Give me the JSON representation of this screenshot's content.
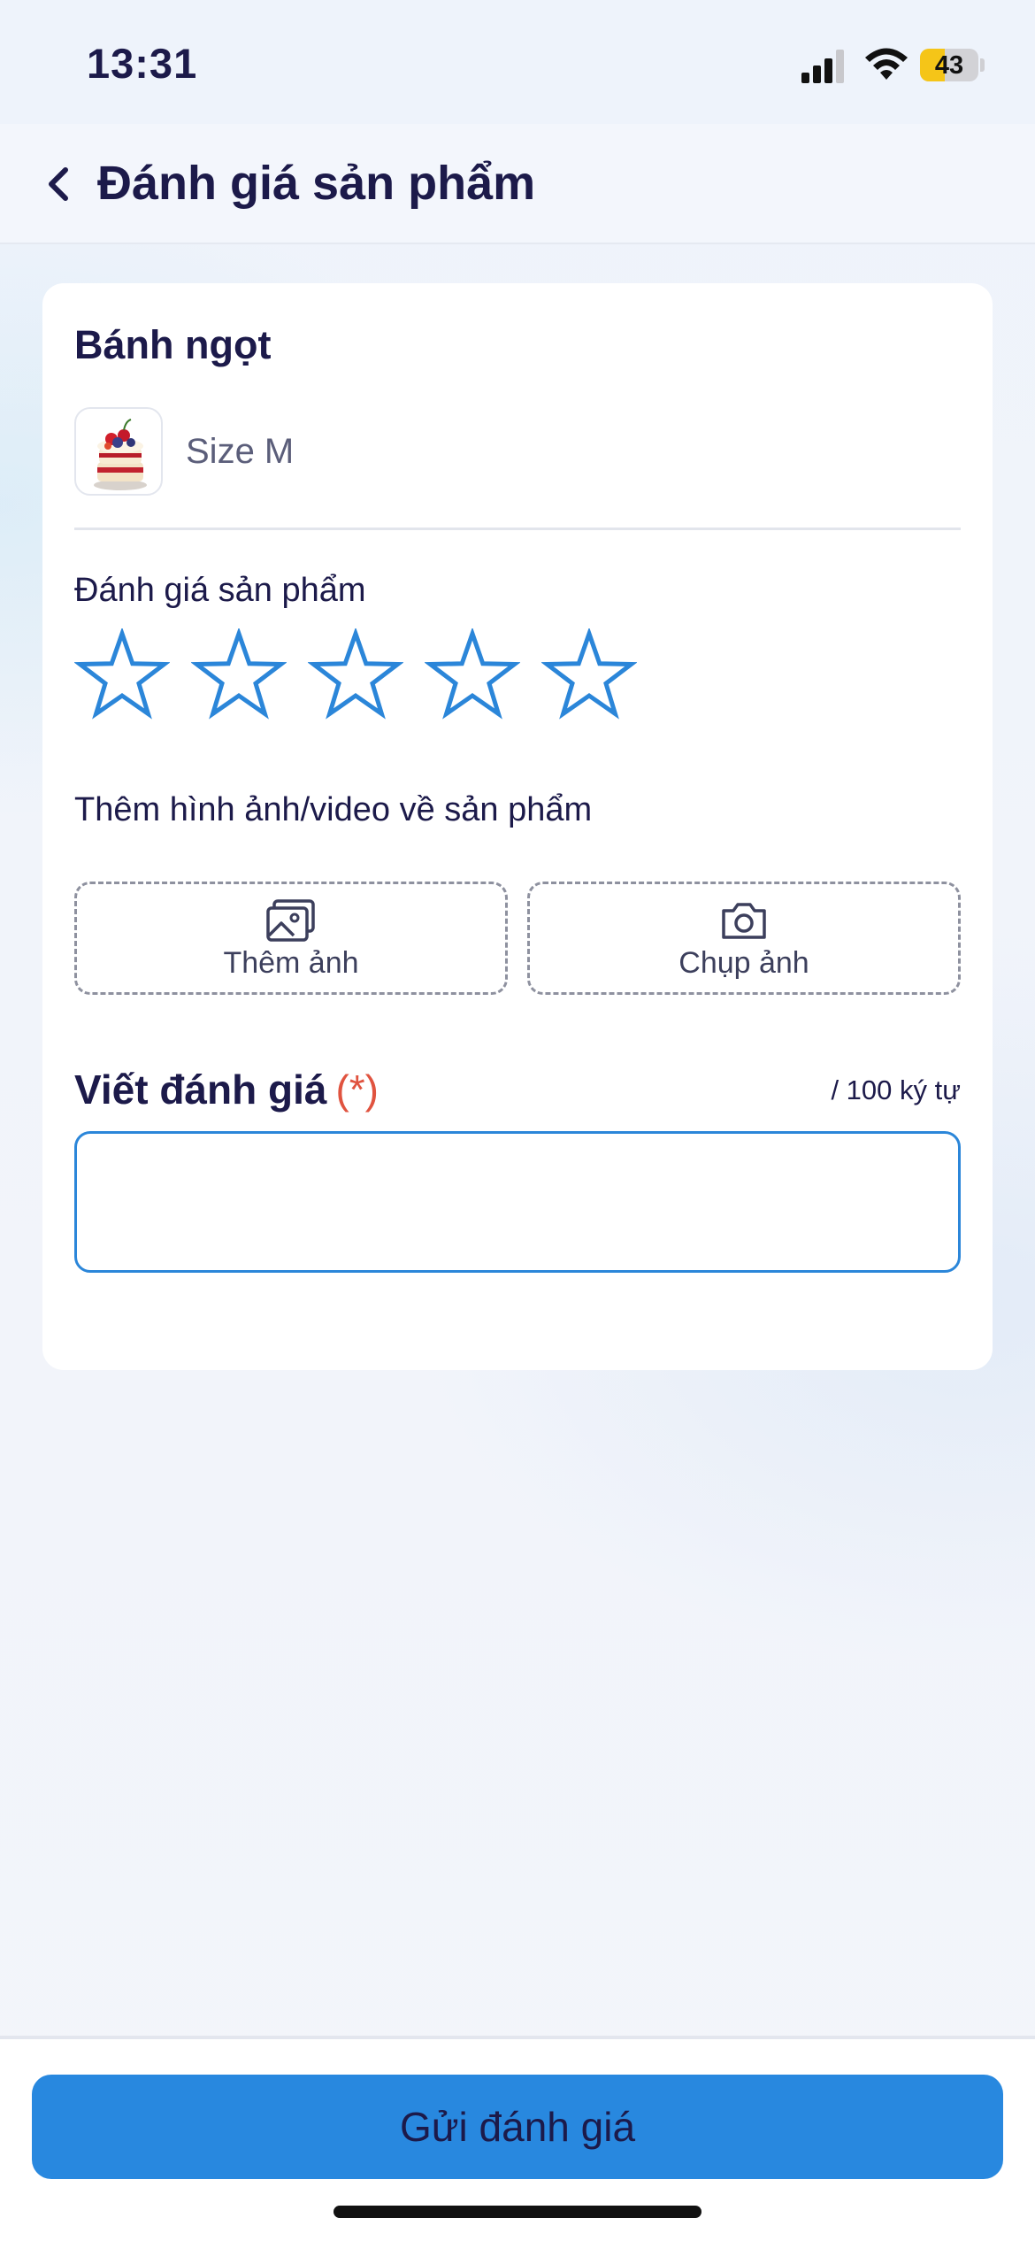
{
  "status_bar": {
    "time": "13:31",
    "battery_level": 43,
    "battery_label": "43",
    "battery_color": "#f5c518"
  },
  "header": {
    "back_icon": "chevron-left-icon",
    "title": "Đánh giá sản phẩm"
  },
  "product": {
    "name": "Bánh ngọt",
    "thumbnail_icon": "cake-image",
    "variant": "Size M"
  },
  "rating": {
    "label": "Đánh giá sản phẩm",
    "max_stars": 5,
    "selected": 0,
    "star_color": "#2b86d9"
  },
  "media": {
    "label": "Thêm hình ảnh/video về sản phẩm",
    "add_photo": {
      "icon": "gallery-icon",
      "label": "Thêm ảnh"
    },
    "take_photo": {
      "icon": "camera-icon",
      "label": "Chụp ảnh"
    }
  },
  "review": {
    "label": "Viết đánh giá",
    "required_mark": "(*)",
    "char_count": "/ 100 ký tự",
    "value": "",
    "placeholder": ""
  },
  "footer": {
    "submit_label": "Gửi đánh giá",
    "accent_color": "#2888df"
  }
}
